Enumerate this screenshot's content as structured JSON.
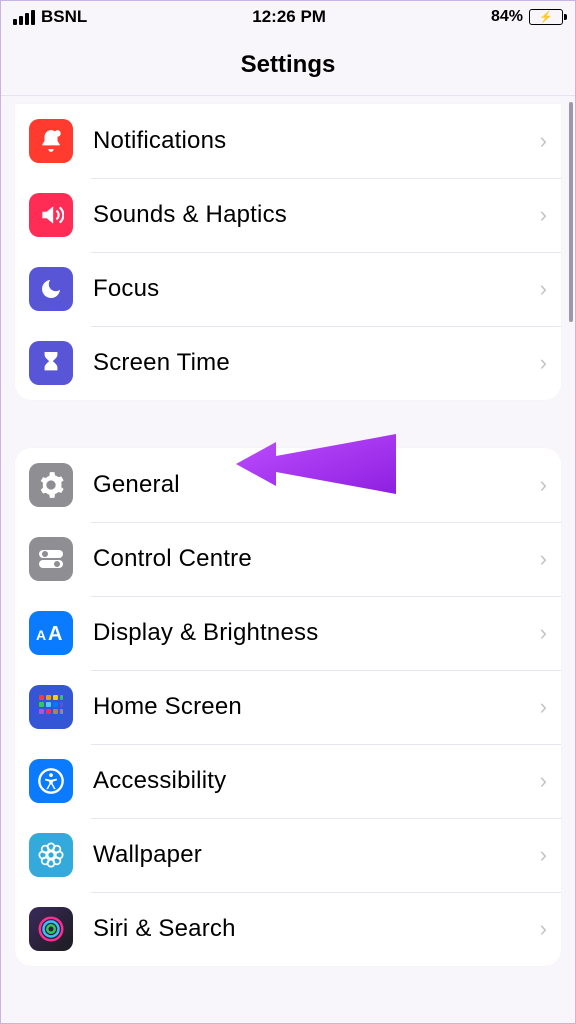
{
  "status_bar": {
    "carrier": "BSNL",
    "time": "12:26 PM",
    "battery_percent": "84%"
  },
  "header": {
    "title": "Settings"
  },
  "groups": [
    {
      "rows": [
        {
          "key": "notifications",
          "label": "Notifications",
          "icon": "bell-badge-icon",
          "bg": "#ff3a2f"
        },
        {
          "key": "sounds",
          "label": "Sounds & Haptics",
          "icon": "speaker-icon",
          "bg": "#ff2d55"
        },
        {
          "key": "focus",
          "label": "Focus",
          "icon": "moon-icon",
          "bg": "#5856d6"
        },
        {
          "key": "screentime",
          "label": "Screen Time",
          "icon": "hourglass-icon",
          "bg": "#5856d6"
        }
      ]
    },
    {
      "rows": [
        {
          "key": "general",
          "label": "General",
          "icon": "gear-icon",
          "bg": "#8e8e93"
        },
        {
          "key": "controlcentre",
          "label": "Control Centre",
          "icon": "switches-icon",
          "bg": "#8e8e93"
        },
        {
          "key": "display",
          "label": "Display & Brightness",
          "icon": "text-size-icon",
          "bg": "#0a7aff"
        },
        {
          "key": "homescreen",
          "label": "Home Screen",
          "icon": "grid-icon",
          "bg": "#3355d6"
        },
        {
          "key": "accessibility",
          "label": "Accessibility",
          "icon": "accessibility-icon",
          "bg": "#0a7aff"
        },
        {
          "key": "wallpaper",
          "label": "Wallpaper",
          "icon": "flower-icon",
          "bg": "#34aadc"
        },
        {
          "key": "siri",
          "label": "Siri & Search",
          "icon": "siri-icon",
          "bg": "#1c1c1e"
        }
      ]
    }
  ],
  "annotation": {
    "type": "arrow",
    "color": "#a020f0",
    "points_to": "general"
  }
}
